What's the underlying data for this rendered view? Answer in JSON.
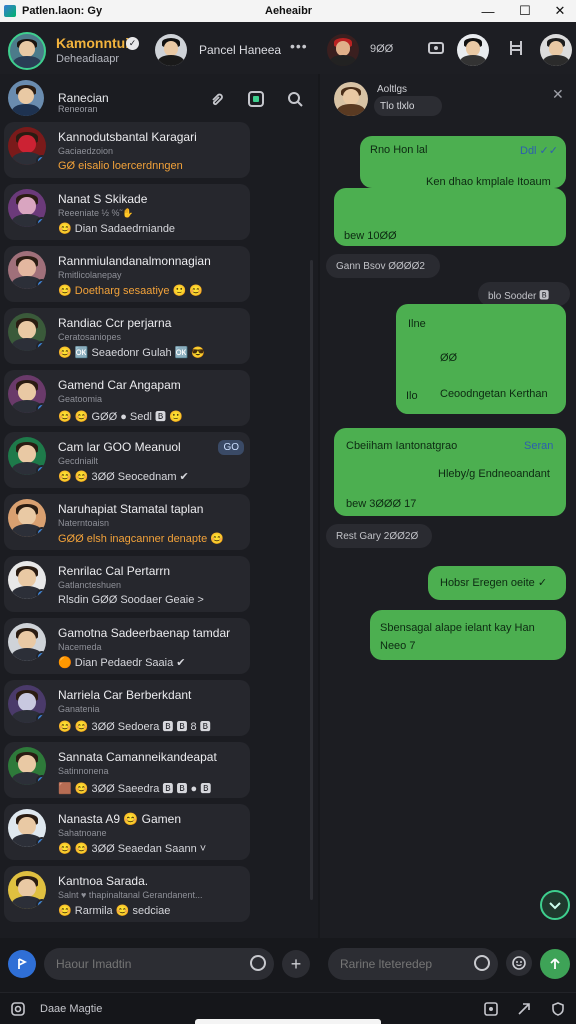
{
  "window": {
    "title_left": "Patlen.laon: Gy",
    "title_center": "Aeheaibr",
    "minimize": "—",
    "maximize": "☐",
    "close": "✕"
  },
  "header": {
    "name": "Kamonntuir",
    "sub": "Deheadiaapr",
    "verified": "✓",
    "contact": "Pancel Haneea",
    "more": "•••",
    "right_num": "9ØØ"
  },
  "sidebar": {
    "top_name": "Ranecian",
    "top_sub": "Reneoran",
    "chats": [
      {
        "name": "Kannodutsbantal Karagari",
        "sub": "Gaciaedzoion",
        "preview": "GØ eisalio loercerdnngen",
        "preview_orange": true,
        "tag": ""
      },
      {
        "name": "Nanat S Skikade",
        "sub": "Reeeniate ½ %̃ ✋",
        "preview": "😊  Dian  Sadaedrniande",
        "preview_orange": false,
        "tag": ""
      },
      {
        "name": "Rannmiulandanalmonnagian",
        "sub": "Rmitlicolanepay",
        "preview": "😊 Doetharg sesaatiye 🙂 😊",
        "preview_orange": true,
        "tag": ""
      },
      {
        "name": "Randiac Ccr perjarna",
        "sub": "Ceratosaniopes",
        "preview": "😊 🆗 Seaedonr Gulah 🆗 😎",
        "preview_orange": false,
        "tag": ""
      },
      {
        "name": "Gamend Car Angapam",
        "sub": "Geatoomia",
        "preview": "😊 😊 GØØ ● Sedl 🅱 🙂",
        "preview_orange": false,
        "tag": ""
      },
      {
        "name": "Cam lar GOO Meanuol",
        "sub": "Gecdniailt",
        "preview": "😊 😊 3ØØ  Seocednam ✔",
        "preview_orange": false,
        "tag": "GO"
      },
      {
        "name": "Naruhapiat Stamatal taplan",
        "sub": "Naterntoaisn",
        "preview": "GØØ elsh inagcanner denapte 😊",
        "preview_orange": true,
        "tag": ""
      },
      {
        "name": "Renrilac Cal Pertarrn",
        "sub": "Gatlancteshuen",
        "preview": "Rlsdin GØØ  Soodaer Geaie ˃",
        "preview_orange": false,
        "tag": ""
      },
      {
        "name": "Gamotna Sadeerbaenap tamdar",
        "sub": "Nacemeda",
        "preview": "🟠  Dian  Pedaedr Saaia ✔",
        "preview_orange": false,
        "tag": ""
      },
      {
        "name": "Narriela Car Berberkdant",
        "sub": "Ganatenia",
        "preview": "😊 😊 3ØØ  Sedoera 🅱 🅱 8 🅱",
        "preview_orange": false,
        "tag": ""
      },
      {
        "name": "Sannata Camanneikandeapat",
        "sub": "Satinnonena",
        "preview": "🟫 😊 3ØØ  Saeedra 🅱 🅱 ● 🅱",
        "preview_orange": false,
        "tag": ""
      },
      {
        "name": "Nanasta A9  😊  Gamen",
        "sub": "Sahatnoane",
        "preview": "😊 😊 3ØØ  Seaedan Saann ˅",
        "preview_orange": false,
        "tag": ""
      },
      {
        "name": "Kantnoa Sarada.",
        "sub": "Salnt ♥ thapinaltanal Gerandanent...",
        "preview": "😊 Rarmila 😊 sedciae",
        "preview_orange": false,
        "tag": ""
      }
    ]
  },
  "left_input": {
    "placeholder": "Haour Imadtin"
  },
  "chat": {
    "contact_name": "Aoltlgs",
    "contact_meta": "Tlo tlxlo",
    "close": "✕",
    "messages": [
      {
        "from": "me",
        "text": "Rno Hon lal",
        "meta": "Ddl ✓✓"
      },
      {
        "from": "me",
        "text": "Ken dhao kmplale Itoaum"
      },
      {
        "from": "me",
        "text": "bew 10ØØ"
      },
      {
        "from": "them",
        "text": "Gann Bsov   ØØØØ2"
      },
      {
        "from": "them",
        "text": "blo  Sooder 🅱"
      },
      {
        "from": "me",
        "text": "Ilne"
      },
      {
        "from": "me",
        "text": "ØØ"
      },
      {
        "from": "me",
        "text": "Ilo"
      },
      {
        "from": "me",
        "text": "Ceoodngetan Kerthan"
      },
      {
        "from": "me",
        "text": "Cbeiiham Iantonatgrao",
        "meta": "Seran"
      },
      {
        "from": "me",
        "text": "Hleby/g  Endneoandant"
      },
      {
        "from": "me",
        "text": "bew  3ØØØ  17"
      },
      {
        "from": "them",
        "text": "Rest  Gary     2ØØ2Ø"
      },
      {
        "from": "me",
        "text": "Hobsr Eregen oeite ✓"
      },
      {
        "from": "me",
        "text": "Sbensagal alape ielant kay Han"
      },
      {
        "from": "me",
        "text": "Neeo 7"
      }
    ]
  },
  "right_input": {
    "placeholder": "Rarine lteteredep"
  },
  "bottom": {
    "label": "Daae Magtie"
  },
  "colors": {
    "accent_green": "#4caf50",
    "accent_orange": "#f2b33d",
    "accent_blue": "#3b82d6",
    "background": "#17181c"
  },
  "icons": {
    "app": "app-icon",
    "search": "search-icon",
    "emoji": "emoji-icon",
    "send": "send-icon",
    "plus": "plus-icon",
    "attach": "attach-icon"
  }
}
